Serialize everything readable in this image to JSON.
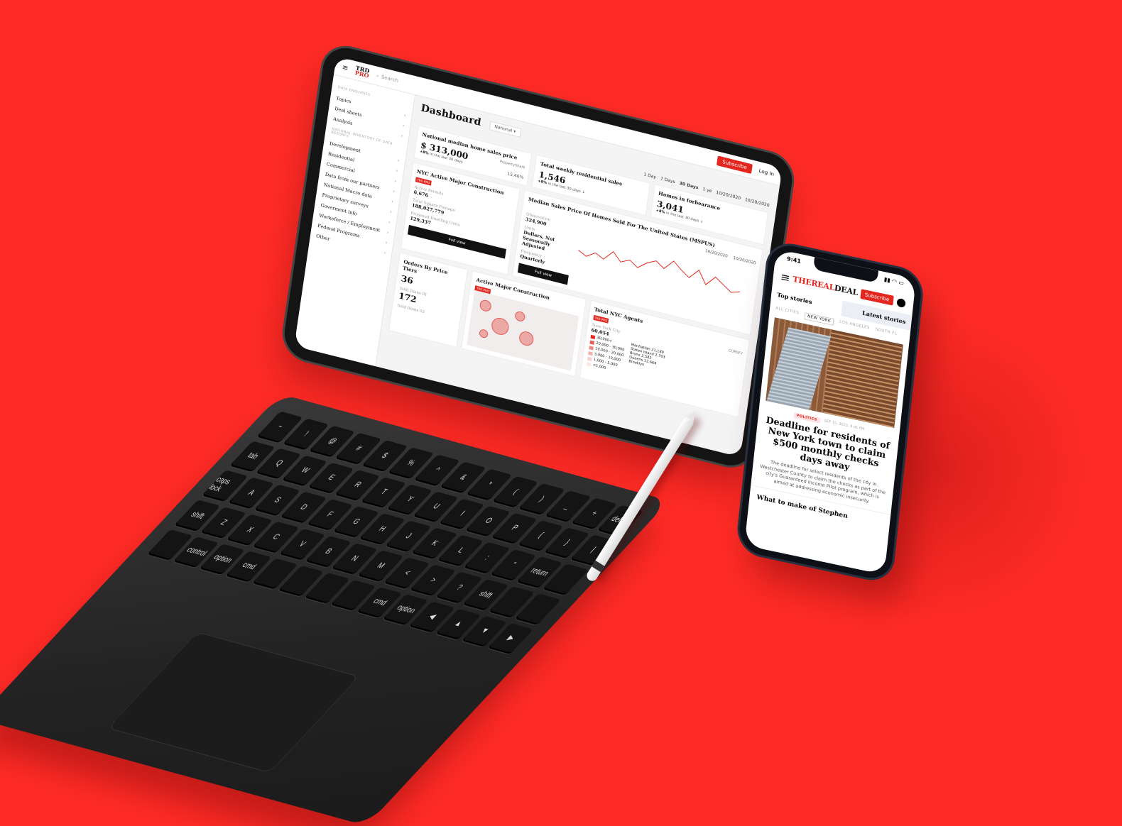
{
  "tablet": {
    "logo_line1": "TRD",
    "logo_line2": "PRO",
    "search_placeholder": "Search",
    "subscribe": "Subscribe",
    "login": "Log In",
    "sidebar": {
      "section1": "DATA ENQUIRIES",
      "items1": [
        "Topics",
        "Deal sheets",
        "Analysis"
      ],
      "section2": "NATIONAL INVENTORY OF DATA REPORTS",
      "items2": [
        "Development",
        "Residential",
        "Commercial",
        "Data from our partners",
        "National Macro data",
        "Proprietary surveys",
        "Goverment info",
        "Workeforce / Employment",
        "Federal Programs",
        "Other"
      ]
    },
    "title": "Dashboard",
    "region": "National",
    "ranges": [
      "1 Day",
      "7 Days",
      "30 Days",
      "1 ye"
    ],
    "active_range": "30 Days",
    "date_from": "10/20/2020",
    "date_to": "10/20/2020",
    "cards": {
      "median": {
        "title": "National median home sales price",
        "value": "$ 313,000",
        "delta": "+8%",
        "delta_text": "in the last 30 days",
        "pct": "15,46%",
        "source": "PropertyShark"
      },
      "weekly": {
        "title": "Total weekly residential sales",
        "value": "1,546",
        "delta": "+8%",
        "delta_text": "in the last 30 days"
      },
      "forbearance": {
        "title": "Homes in forbearance",
        "value": "3,041",
        "delta": "+8%",
        "delta_text": "in the last 30 days"
      }
    },
    "construction": {
      "title": "NYC Active Major Construction",
      "tag": "TRD PRO",
      "stats": [
        {
          "label": "Active Permits",
          "value": "6,676"
        },
        {
          "label": "Total Square Footage",
          "value": "188,027,779"
        },
        {
          "label": "Proposed Dwelling Units",
          "value": "129,337"
        }
      ],
      "button": "Full view"
    },
    "mspus": {
      "title": "Median Sales Price Of Homes Sold For The United States (MSPUS)",
      "observation_label": "Observation",
      "observation": "324,900",
      "units_label": "Units",
      "units": "Dollars, Not Seasonally Adjusted",
      "frequency_label": "Frequency",
      "frequency": "Quarterly",
      "button": "Full view",
      "date_from": "10/20/2020",
      "date_to": "10/20/2020"
    },
    "orders": {
      "title": "Orders By Price Tiers",
      "v1": "36",
      "l1": "Sold Items 01",
      "v2": "172",
      "l2": "Sold Items 02"
    },
    "active_map": {
      "title": "Active Major Construction",
      "tag": "TRD PRO"
    },
    "agents": {
      "title": "Total NYC Agents",
      "tag": "TRD PRO",
      "city": "New York City",
      "total": "60,054",
      "legend": [
        "30,000+",
        "20,000 - 30,000",
        "10,000 - 20,000",
        "5,000 - 10,000",
        "1,000 - 5,000",
        "<1,000"
      ],
      "legend_colors": [
        "#e3271f",
        "#ea5a52",
        "#f08a84",
        "#f5b0ab",
        "#f9cfcc",
        "#fce6e4"
      ],
      "source": "CORSFY",
      "boroughs": [
        {
          "name": "Manhattan",
          "value": "21,189"
        },
        {
          "name": "Staten Island",
          "value": "2,703"
        },
        {
          "name": "Bronx",
          "value": "2,582"
        },
        {
          "name": "Queens",
          "value": "12,664"
        },
        {
          "name": "Brooklyn",
          "value": ""
        }
      ]
    }
  },
  "keyboard": {
    "rows": [
      [
        "~",
        "!",
        "@",
        "#",
        "$",
        "%",
        "^",
        "&",
        "*",
        "(",
        ")",
        "_",
        "+",
        "delete"
      ],
      [
        "tab",
        "Q",
        "W",
        "E",
        "R",
        "T",
        "Y",
        "U",
        "I",
        "O",
        "P",
        "{",
        "}",
        "|"
      ],
      [
        "caps lock",
        "A",
        "S",
        "D",
        "F",
        "G",
        "H",
        "J",
        "K",
        "L",
        ":",
        "\"",
        "return",
        ""
      ],
      [
        "shift",
        "Z",
        "X",
        "C",
        "V",
        "B",
        "N",
        "M",
        "<",
        ">",
        "?",
        "shift",
        "",
        ""
      ],
      [
        "",
        "control",
        "option",
        "cmd",
        "",
        "",
        "",
        "",
        "cmd",
        "option",
        "◀",
        "▲",
        "▼",
        "▶"
      ]
    ]
  },
  "phone": {
    "time": "9:41",
    "logo_a": "THE",
    "logo_b": "REAL",
    "logo_c": "DEAL",
    "subscribe": "Subscribe",
    "tab_top": "Top stories",
    "tab_latest": "Latest stories",
    "cities": [
      "ALL CITIES",
      "NEW YORK",
      "LOS ANGELES",
      "SOUTH FL"
    ],
    "selected_city": "NEW YORK",
    "category": "POLITICS",
    "date": "SEP 15, 2023, 8:41 PM",
    "headline": "Deadline for residents of New York town to claim $500 monthly checks days away",
    "dek": "The deadline for select residents of the city in Westchester County to claim the checks as part of the city's Guaranteed Income Pilot program, which is aimed at addressing economic insecurity.",
    "next": "What to make of Stephen"
  }
}
